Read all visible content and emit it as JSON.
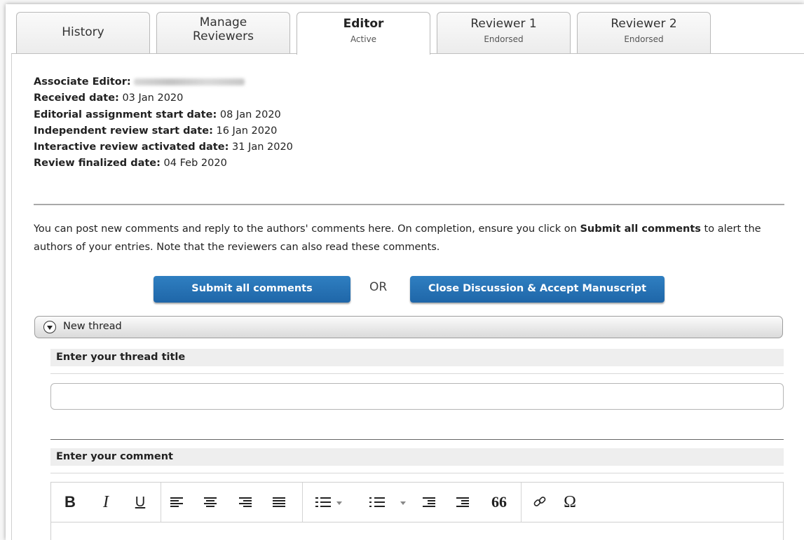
{
  "tabs": [
    {
      "label": "History",
      "sub": ""
    },
    {
      "label": "Manage",
      "label2": "Reviewers",
      "sub": ""
    },
    {
      "label": "Editor",
      "sub": "Active"
    },
    {
      "label": "Reviewer 1",
      "sub": "Endorsed"
    },
    {
      "label": "Reviewer 2",
      "sub": "Endorsed"
    }
  ],
  "meta": {
    "associate_editor_label": "Associate Editor:",
    "received_label": "Received date:",
    "received_value": "03 Jan 2020",
    "assignment_label": "Editorial assignment start date:",
    "assignment_value": "08 Jan 2020",
    "independent_label": "Independent review start date:",
    "independent_value": "16 Jan 2020",
    "interactive_label": "Interactive review activated date:",
    "interactive_value": "31 Jan 2020",
    "finalized_label": "Review finalized date:",
    "finalized_value": "04 Feb 2020"
  },
  "intro": {
    "part1": "You can post new comments and reply to the authors' comments here. On completion, ensure you click on ",
    "bold": "Submit all comments",
    "part2": " to alert the authors of your entries. Note that the reviewers can also read these comments."
  },
  "actions": {
    "submit_label": "Submit all comments",
    "or_label": "OR",
    "close_label": "Close Discussion & Accept Manuscript"
  },
  "thread": {
    "toggle_label": "New thread",
    "title_heading": "Enter your thread title",
    "title_value": "",
    "comment_heading": "Enter your comment"
  },
  "toolbar": {
    "bold": "B",
    "italic": "I",
    "underline": "U",
    "quote": "66",
    "special": "Ω"
  },
  "colors": {
    "button_blue": "#2572b4",
    "border_gray": "#b9b9b9"
  }
}
